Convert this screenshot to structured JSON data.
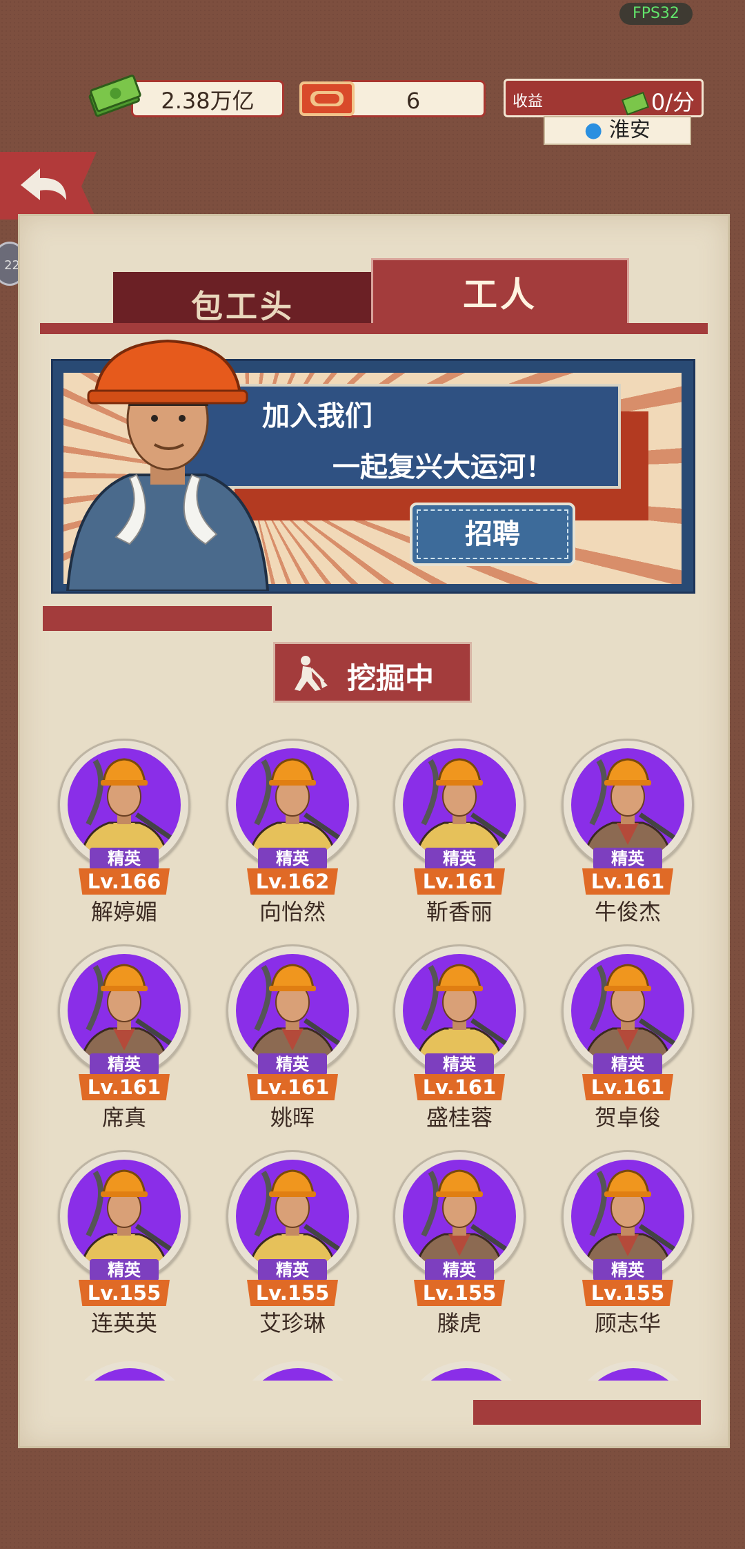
{
  "status": {
    "fps": "FPS32"
  },
  "header": {
    "money": "2.38万亿",
    "tickets": "6",
    "income_label": "收益",
    "income_value": "0/分",
    "location": "淮安"
  },
  "side_badge": "22",
  "tabs": [
    {
      "label": "包工头",
      "active": false
    },
    {
      "label": "工人",
      "active": true
    }
  ],
  "banner": {
    "line1": "加入我们",
    "line2": "一起复兴大运河！",
    "recruit_label": "招聘"
  },
  "section": {
    "digging_label": "挖掘中"
  },
  "colors": {
    "accent_red": "#a33c3c",
    "grade_purple": "#8a2ee8",
    "level_orange": "#e06a26"
  },
  "workers": [
    {
      "grade": "精英",
      "level": "Lv.166",
      "name": "解婷媚",
      "gender": "female"
    },
    {
      "grade": "精英",
      "level": "Lv.162",
      "name": "向怡然",
      "gender": "female"
    },
    {
      "grade": "精英",
      "level": "Lv.161",
      "name": "靳香丽",
      "gender": "female"
    },
    {
      "grade": "精英",
      "level": "Lv.161",
      "name": "牛俊杰",
      "gender": "male"
    },
    {
      "grade": "精英",
      "level": "Lv.161",
      "name": "席真",
      "gender": "male"
    },
    {
      "grade": "精英",
      "level": "Lv.161",
      "name": "姚晖",
      "gender": "male"
    },
    {
      "grade": "精英",
      "level": "Lv.161",
      "name": "盛桂蓉",
      "gender": "female"
    },
    {
      "grade": "精英",
      "level": "Lv.161",
      "name": "贺卓俊",
      "gender": "male"
    },
    {
      "grade": "精英",
      "level": "Lv.155",
      "name": "连英英",
      "gender": "female"
    },
    {
      "grade": "精英",
      "level": "Lv.155",
      "name": "艾珍琳",
      "gender": "female"
    },
    {
      "grade": "精英",
      "level": "Lv.155",
      "name": "滕虎",
      "gender": "male"
    },
    {
      "grade": "精英",
      "level": "Lv.155",
      "name": "顾志华",
      "gender": "male"
    }
  ]
}
